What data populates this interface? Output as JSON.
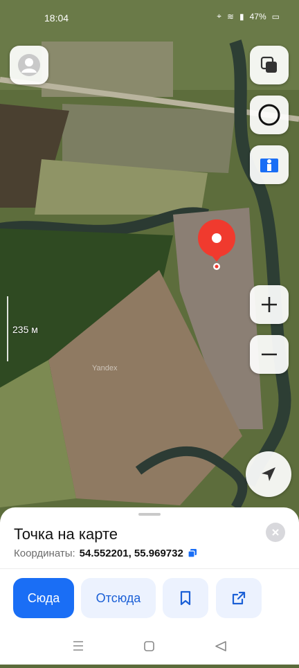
{
  "status_bar": {
    "time": "18:04",
    "battery": "47%"
  },
  "map": {
    "scale_label": "235 м",
    "watermark": "Yandex"
  },
  "sheet": {
    "title": "Точка на карте",
    "coords_label": "Координаты:",
    "coords_value": "54.552201, 55.969732"
  },
  "actions": {
    "here_label": "Сюда",
    "from_label": "Отсюда"
  },
  "colors": {
    "accent": "#1a6ef5",
    "pin": "#f03a2e"
  }
}
